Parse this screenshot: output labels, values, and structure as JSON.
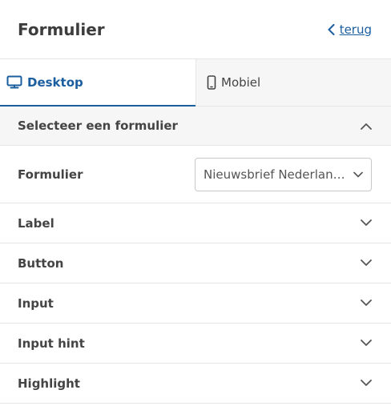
{
  "header": {
    "title": "Formulier",
    "back_label": "terug"
  },
  "tabs": [
    {
      "label": "Desktop",
      "icon": "monitor-icon",
      "active": true
    },
    {
      "label": "Mobiel",
      "icon": "phone-icon",
      "active": false
    }
  ],
  "sections": {
    "form_select": {
      "label": "Selecteer een formulier",
      "field_label": "Formulier",
      "selected_value": "Nieuwsbrief Nederland..."
    },
    "label": "Label",
    "button": "Button",
    "input": "Input",
    "input_hint": "Input hint",
    "highlight": "Highlight"
  },
  "colors": {
    "accent": "#1a5e9f",
    "tab_inactive_bg": "#f6f6f7",
    "border": "#e6e6e6"
  }
}
